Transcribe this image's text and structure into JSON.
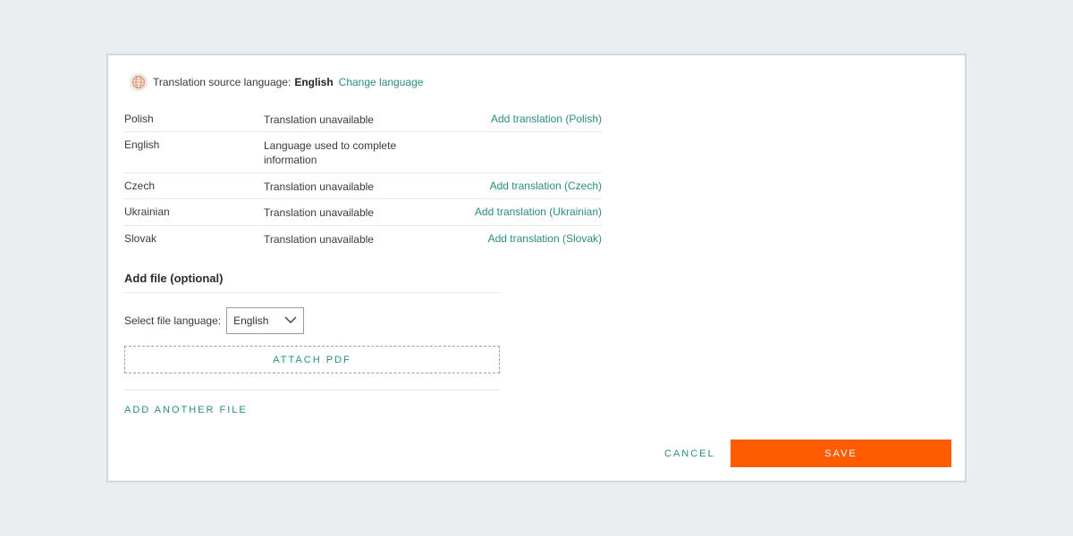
{
  "source_language": {
    "label": "Translation source language:",
    "value": "English",
    "change_link": "Change language"
  },
  "languages": [
    {
      "language": "Polish",
      "status": "Translation unavailable",
      "action": "Add translation (Polish)"
    },
    {
      "language": "English",
      "status": "Language used to complete information",
      "action": ""
    },
    {
      "language": "Czech",
      "status": "Translation unavailable",
      "action": "Add translation (Czech)"
    },
    {
      "language": "Ukrainian",
      "status": "Translation unavailable",
      "action": "Add translation (Ukrainian)"
    },
    {
      "language": "Slovak",
      "status": "Translation unavailable",
      "action": "Add translation (Slovak)"
    }
  ],
  "add_file": {
    "title": "Add file (optional)",
    "select_label": "Select file language:",
    "selected_language": "English",
    "attach_label": "ATTACH PDF",
    "add_another_label": "ADD ANOTHER FILE"
  },
  "footer": {
    "cancel_label": "CANCEL",
    "save_label": "SAVE"
  },
  "colors": {
    "accent": "#2a8c80",
    "save_button": "#ff5c00",
    "background": "#eaeef1"
  },
  "icons": {
    "source_language": "globe-icon",
    "select": "chevron-down-icon"
  }
}
